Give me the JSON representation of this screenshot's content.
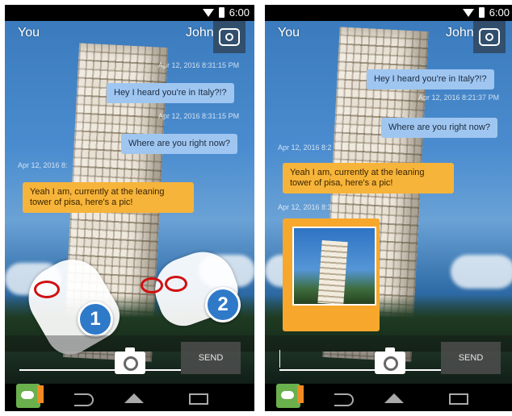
{
  "screens": {
    "left": {
      "status_time": "6:00",
      "you_label": "You",
      "contact_name": "John",
      "timestamps": [
        "Apr 12, 2016 8:31:15 PM",
        "Apr 12, 2016 8:31:15 PM",
        "Apr 12, 2016 8:"
      ],
      "messages": [
        "Hey I heard you're in Italy?!?",
        "Where are you right now?",
        "Yeah I am, currently at the leaning tower of pisa, here's a pic!"
      ],
      "send_label": "SEND",
      "gesture_steps": [
        "1",
        "2"
      ]
    },
    "right": {
      "status_time": "6:00",
      "you_label": "You",
      "contact_name": "John",
      "timestamps": [
        "Apr 12, 2016 8:21:37 PM",
        "Apr 12, 2016 8:2",
        "Apr 12, 2016 8:3"
      ],
      "messages": [
        "Hey I heard you're in Italy?!?",
        "Where are you right now?",
        "Yeah I am, currently at the leaning tower of pisa, here's a pic!"
      ],
      "send_label": "SEND"
    }
  },
  "icons": {
    "status": [
      "wifi-icon",
      "battery-icon"
    ],
    "contact": "contact-photo-icon",
    "composer": [
      "camera-icon"
    ],
    "nav": [
      "back-icon",
      "home-icon",
      "recents-icon"
    ],
    "app": "messaging-app-icon"
  },
  "colors": {
    "incoming_bubble": "#9fc6f0",
    "outgoing_bubble": "#f7b43a",
    "step_badge": "#2f79c9",
    "touch_ring": "#d01010"
  }
}
